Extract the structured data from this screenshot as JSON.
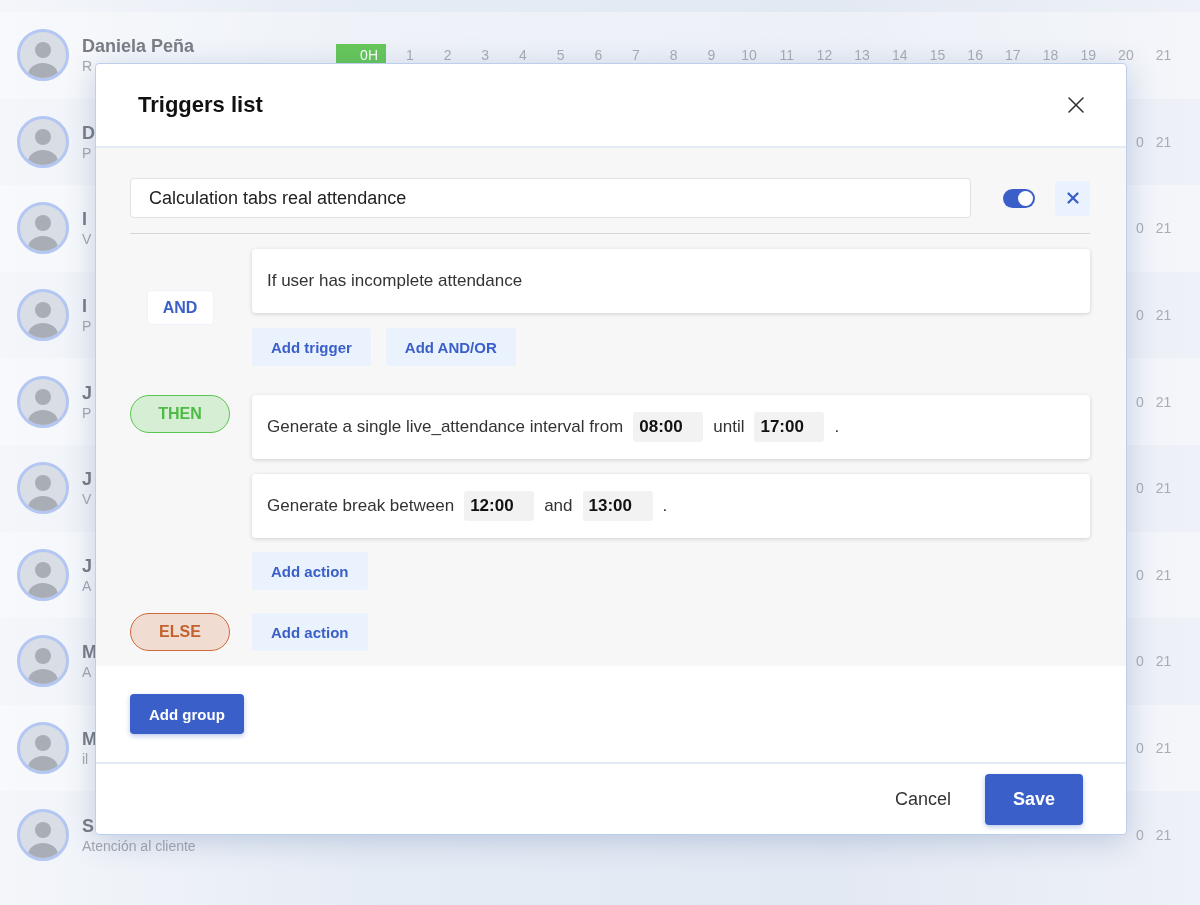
{
  "background": {
    "rows": [
      {
        "name": "Daniela Peña",
        "subtitle": "R",
        "current_hour": "0H",
        "hours": [
          "1",
          "2",
          "3",
          "4",
          "5",
          "6",
          "7",
          "8",
          "9",
          "10",
          "11",
          "12",
          "13",
          "14",
          "15",
          "16",
          "17",
          "18",
          "19",
          "20",
          "21"
        ]
      },
      {
        "name": "D",
        "subtitle": "P",
        "hours": [
          "0",
          "21"
        ]
      },
      {
        "name": "I",
        "subtitle": "V",
        "hours": [
          "0",
          "21"
        ]
      },
      {
        "name": "I",
        "subtitle": "P",
        "hours": [
          "0",
          "21"
        ]
      },
      {
        "name": "J",
        "subtitle": "P",
        "hours": [
          "0",
          "21"
        ]
      },
      {
        "name": "J",
        "subtitle": "V",
        "hours": [
          "0",
          "21"
        ]
      },
      {
        "name": "J",
        "subtitle": "A",
        "hours": [
          "0",
          "21"
        ]
      },
      {
        "name": "M",
        "subtitle": "A",
        "hours": [
          "0",
          "21"
        ]
      },
      {
        "name": "M",
        "subtitle": "il",
        "hours": [
          "0",
          "21"
        ]
      },
      {
        "name": "S",
        "subtitle": "Atención al cliente",
        "hours": [
          "0",
          "21"
        ]
      }
    ]
  },
  "dialog": {
    "title": "Triggers list",
    "trigger": {
      "name": "Calculation tabs real attendance",
      "enabled": true
    },
    "condition": {
      "operator": "AND",
      "text": "If user has incomplete attendance",
      "buttons": [
        "Add trigger",
        "Add AND/OR"
      ]
    },
    "branches": [
      {
        "kind": "then",
        "label": "THEN",
        "actions": [
          {
            "parts": [
              {
                "kind": "text",
                "text": "Generate a single live_attendance interval from"
              },
              {
                "kind": "value",
                "text": "08:00"
              },
              {
                "kind": "text",
                "text": "until"
              },
              {
                "kind": "value",
                "text": "17:00"
              },
              {
                "kind": "text",
                "text": "."
              }
            ]
          },
          {
            "parts": [
              {
                "kind": "text",
                "text": "Generate break between"
              },
              {
                "kind": "value",
                "text": "12:00"
              },
              {
                "kind": "text",
                "text": "and"
              },
              {
                "kind": "value",
                "text": "13:00"
              },
              {
                "kind": "text",
                "text": "."
              }
            ]
          }
        ],
        "add_button": "Add action"
      },
      {
        "kind": "else",
        "label": "ELSE",
        "add_button": "Add action"
      }
    ],
    "add_group": "Add group",
    "footer": {
      "cancel": "Cancel",
      "save": "Save"
    }
  }
}
